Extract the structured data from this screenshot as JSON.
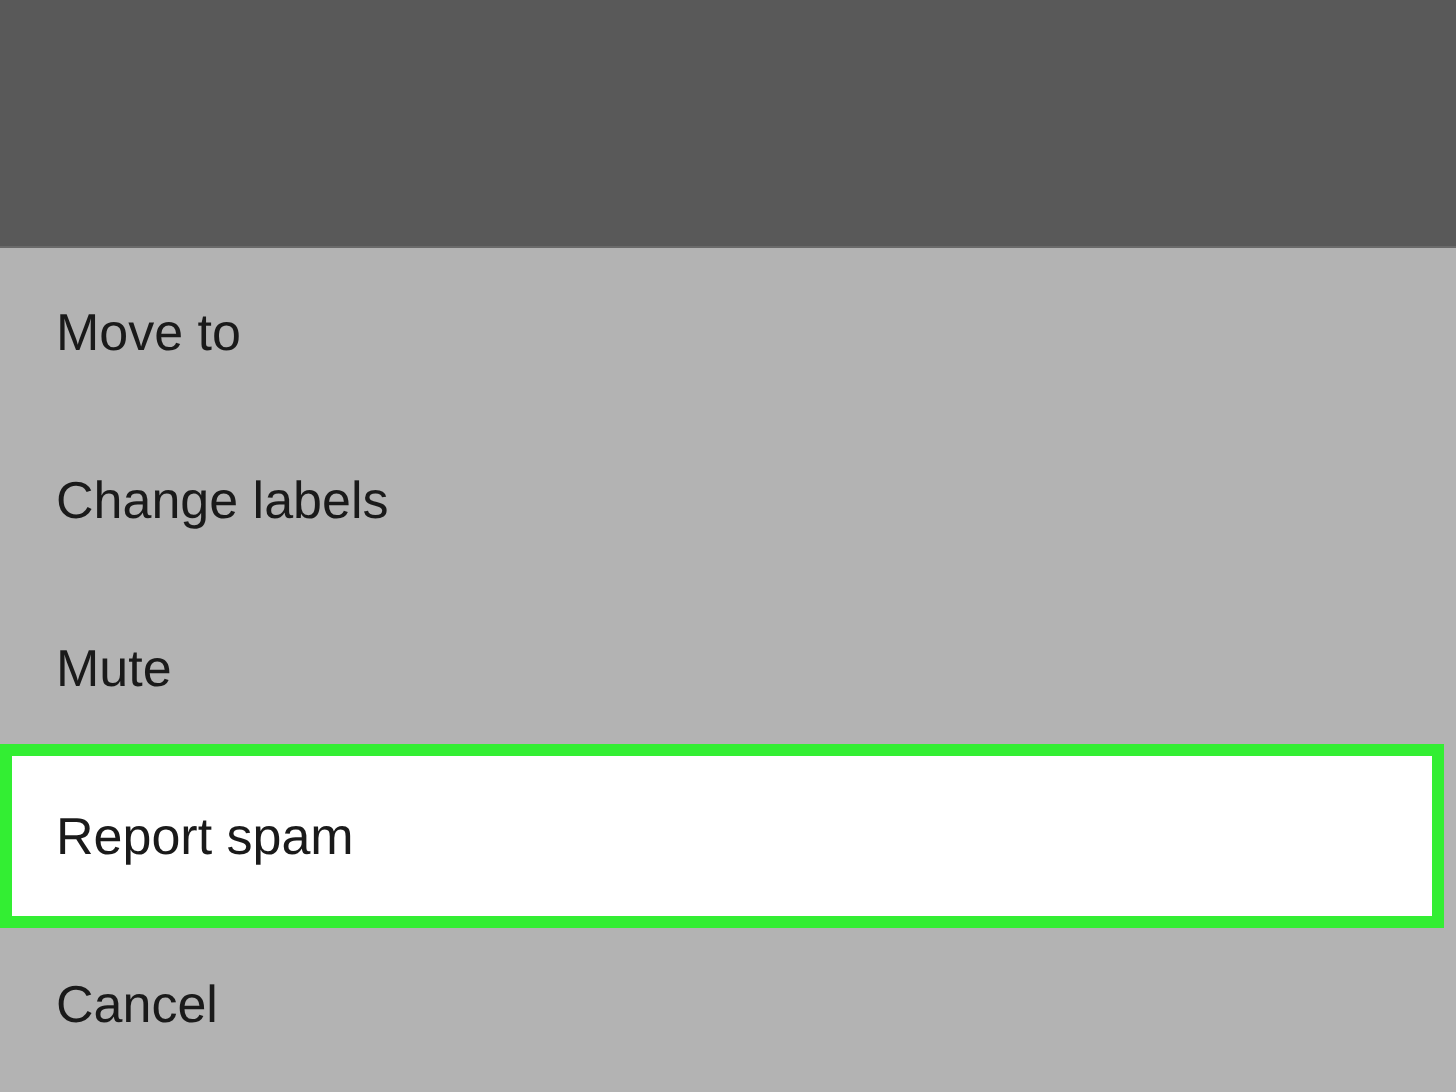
{
  "menu": {
    "items": [
      {
        "label": "Move to",
        "highlighted": false
      },
      {
        "label": "Change labels",
        "highlighted": false
      },
      {
        "label": "Mute",
        "highlighted": false
      },
      {
        "label": "Report spam",
        "highlighted": true
      },
      {
        "label": "Cancel",
        "highlighted": false
      }
    ]
  }
}
